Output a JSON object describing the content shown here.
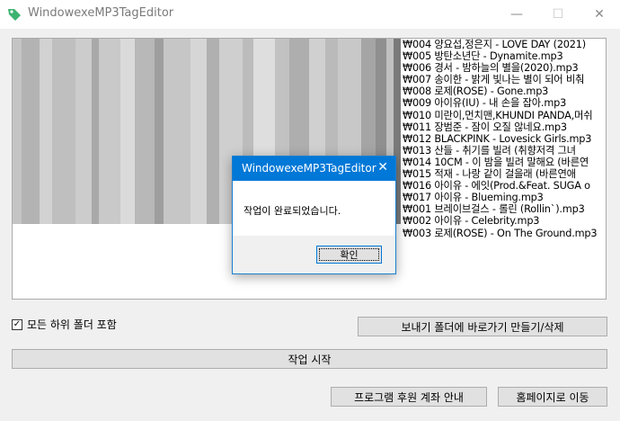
{
  "window": {
    "title": "WindowexeMP3TagEditor",
    "minimize": "—",
    "maximize": "☐",
    "close": "✕"
  },
  "file_list": [
    "₩004 양요섭,정은지 - LOVE DAY (2021)",
    "₩005 방탄소년단 - Dynamite.mp3",
    "₩006 경서 - 밤하늘의 별을(2020).mp3",
    "₩007 송이한 - 밝게 빛나는 별이 되어 비춰",
    "₩008 로제(ROSE) - Gone.mp3",
    "₩009 아이유(IU) - 내 손을 잡아.mp3",
    "₩010 미란이,먼치맨,KHUNDI PANDA,머쉬",
    "₩011 장범준 - 잠이 오질 않네요.mp3",
    "₩012 BLACKPINK - Lovesick Girls.mp3",
    "₩013 산들 - 취기를 빌려 (취향저격 그녀",
    "₩014 10CM - 이 밤을 빌려 말해요 (바른연",
    "₩015 적재 - 나랑 같이 걸을래 (바른연애",
    "₩016 아이유 - 에잇(Prod.&Feat. SUGA o",
    "₩017 아이유 - Blueming.mp3",
    "₩001 브레이브걸스 - 롤린 (Rollin`).mp3",
    "₩002 아이유 - Celebrity.mp3",
    "₩003 로제(ROSE) - On The Ground.mp3"
  ],
  "options": {
    "include_subfolders_label": "모든 하위 폴더 포함",
    "include_subfolders_checked": true,
    "check_mark": "✓"
  },
  "buttons": {
    "send_to_folder": "보내기 폴더에 바로가기 만들기/삭제",
    "start": "작업 시작",
    "donate": "프로그램 후원 계좌 안내",
    "homepage": "홈페이지로 이동"
  },
  "dialog": {
    "title": "WindowexeMP3TagEditor",
    "close": "✕",
    "message": "작업이 완료되었습니다.",
    "ok": "확인"
  },
  "colors": {
    "dialog_title_bg": "#0078d7",
    "app_icon": "#3cb371"
  }
}
